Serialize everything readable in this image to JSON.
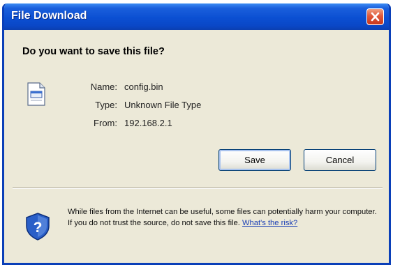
{
  "window": {
    "title": "File Download"
  },
  "dialog": {
    "question": "Do you want to save this file?",
    "file": {
      "name_label": "Name:",
      "name_value": "config.bin",
      "type_label": "Type:",
      "type_value": "Unknown File Type",
      "from_label": "From:",
      "from_value": "192.168.2.1"
    },
    "buttons": {
      "save": "Save",
      "cancel": "Cancel"
    },
    "warning": {
      "text": "While files from the Internet can be useful, some files can potentially harm your computer. If you do not trust the source, do not save this file.",
      "link": "What's the risk?"
    }
  },
  "icons": {
    "close": "close-icon",
    "file": "file-icon",
    "shield": "shield-icon"
  },
  "colors": {
    "titlebar": "#0b4fd2",
    "close_button": "#e0583a",
    "dialog_background": "#ece9d8",
    "link": "#1a3fb5"
  }
}
